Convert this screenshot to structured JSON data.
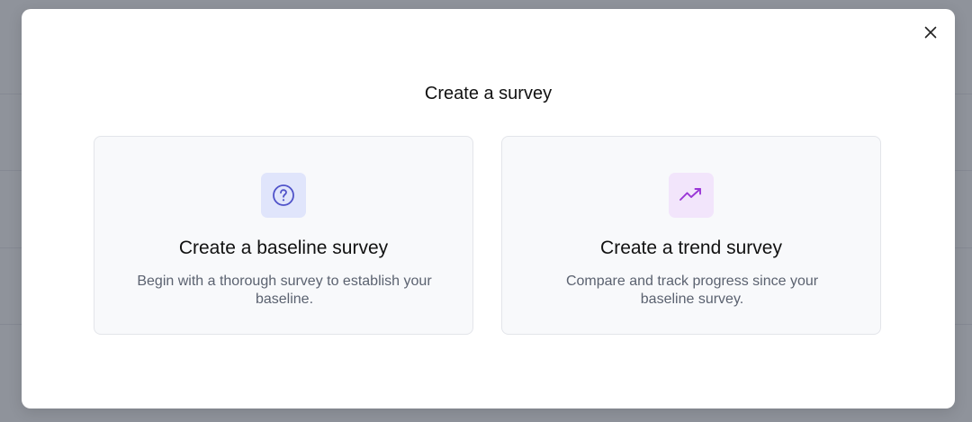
{
  "modal": {
    "title": "Create a survey",
    "close_icon": "close-icon"
  },
  "options": [
    {
      "title": "Create a baseline survey",
      "description": "Begin with a thorough survey to establish your baseline.",
      "icon": "question-circle-icon",
      "icon_color": "#4f52c9",
      "icon_bg": "#e0e5fb"
    },
    {
      "title": "Create a trend survey",
      "description": "Compare and track progress since your baseline survey.",
      "icon": "trending-up-icon",
      "icon_color": "#9a36d6",
      "icon_bg": "#f2e5fb"
    }
  ]
}
